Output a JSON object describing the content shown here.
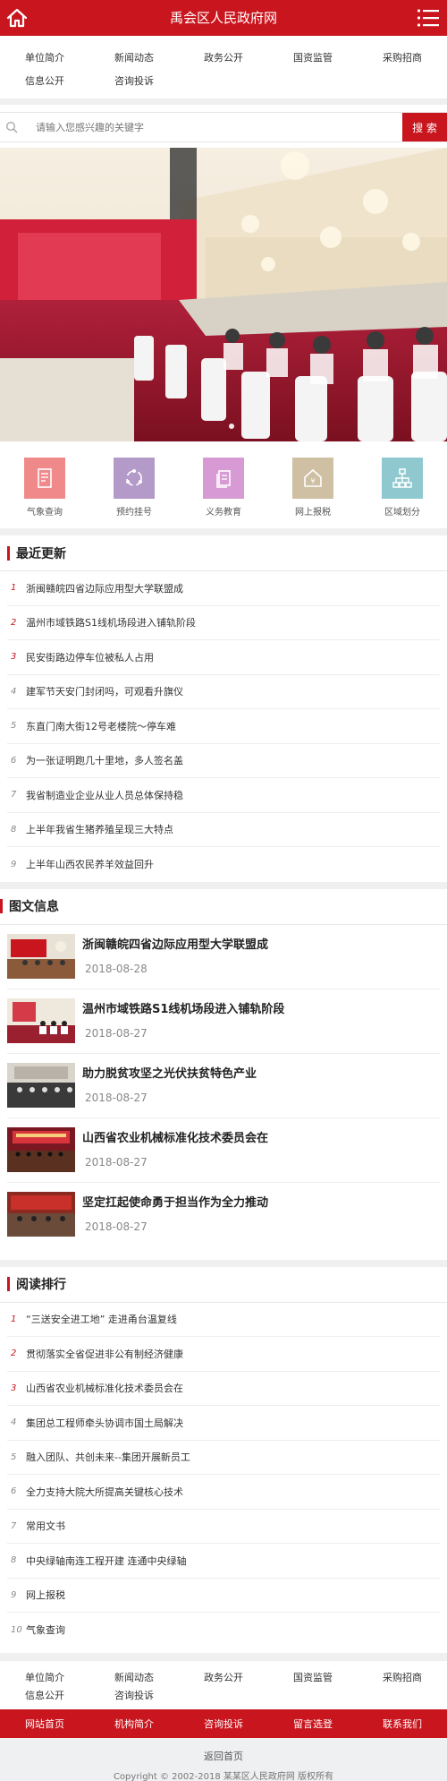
{
  "header": {
    "title": "禹会区人民政府网"
  },
  "topnav": {
    "row1": [
      "单位简介",
      "新闻动态",
      "政务公开",
      "国资监管",
      "采购招商"
    ],
    "row2": [
      "信息公开",
      "咨询投诉"
    ]
  },
  "search": {
    "placeholder": "请输入您感兴趣的关键字",
    "button": "搜 索"
  },
  "quick": [
    {
      "label": "气象查询",
      "icon": "document-icon",
      "color": "#f08a8a"
    },
    {
      "label": "预约挂号",
      "icon": "cycle-icon",
      "color": "#b49ac8"
    },
    {
      "label": "义务教育",
      "icon": "files-icon",
      "color": "#d79ad4"
    },
    {
      "label": "网上报税",
      "icon": "house-yen-icon",
      "color": "#cfbfa3"
    },
    {
      "label": "区域划分",
      "icon": "org-chart-icon",
      "color": "#8fc9cf"
    }
  ],
  "latest": {
    "title": "最近更新",
    "items": [
      {
        "num": "1",
        "text": "浙闽赣皖四省边际应用型大学联盟成"
      },
      {
        "num": "2",
        "text": "温州市域铁路S1线机场段进入铺轨阶段"
      },
      {
        "num": "3",
        "text": "民安街路边停车位被私人占用"
      },
      {
        "num": "4",
        "text": "建军节天安门封闭吗，可观看升旗仪"
      },
      {
        "num": "5",
        "text": "东直门南大街12号老楼院～停车难"
      },
      {
        "num": "6",
        "text": "为一张证明跑几十里地，多人签名盖"
      },
      {
        "num": "7",
        "text": "我省制造业企业从业人员总体保持稳"
      },
      {
        "num": "8",
        "text": "上半年我省生猪养殖呈现三大特点"
      },
      {
        "num": "9",
        "text": "上半年山西农民养羊效益回升"
      }
    ]
  },
  "photos": {
    "title": "图文信息",
    "items": [
      {
        "title": "浙闽赣皖四省边际应用型大学联盟成",
        "date": "2018-08-28"
      },
      {
        "title": "温州市域铁路S1线机场段进入铺轨阶段",
        "date": "2018-08-27"
      },
      {
        "title": "助力脱贫攻坚之光伏扶贫特色产业",
        "date": "2018-08-27"
      },
      {
        "title": "山西省农业机械标准化技术委员会在",
        "date": "2018-08-27"
      },
      {
        "title": "坚定扛起使命勇于担当作为全力推动",
        "date": "2018-08-27"
      }
    ]
  },
  "ranking": {
    "title": "阅读排行",
    "items": [
      {
        "num": "1",
        "text": "“三送安全进工地” 走进甬台温复线"
      },
      {
        "num": "2",
        "text": "贯彻落实全省促进非公有制经济健康"
      },
      {
        "num": "3",
        "text": "山西省农业机械标准化技术委员会在"
      },
      {
        "num": "4",
        "text": "集团总工程师牵头协调市国土局解决"
      },
      {
        "num": "5",
        "text": "融入团队、共创未来--集团开展新员工"
      },
      {
        "num": "6",
        "text": "全力支持大院大所提高关键核心技术"
      },
      {
        "num": "7",
        "text": "常用文书"
      },
      {
        "num": "8",
        "text": "中央绿轴南连工程开建 连通中央绿轴"
      },
      {
        "num": "9",
        "text": "网上报税"
      },
      {
        "num": "10",
        "text": "气象查询"
      }
    ]
  },
  "footer_nav": {
    "row1": [
      "单位简介",
      "新闻动态",
      "政务公开",
      "国资监管",
      "采购招商"
    ],
    "row2": [
      "信息公开",
      "咨询投诉"
    ]
  },
  "redbar": [
    "网站首页",
    "机构简介",
    "咨询投诉",
    "留言选登",
    "联系我们"
  ],
  "bottom": {
    "back": "返回首页",
    "copyright": "Copyright © 2002-2018 某某区人民政府网 版权所有"
  },
  "colors": {
    "brand": "#c9151e"
  }
}
